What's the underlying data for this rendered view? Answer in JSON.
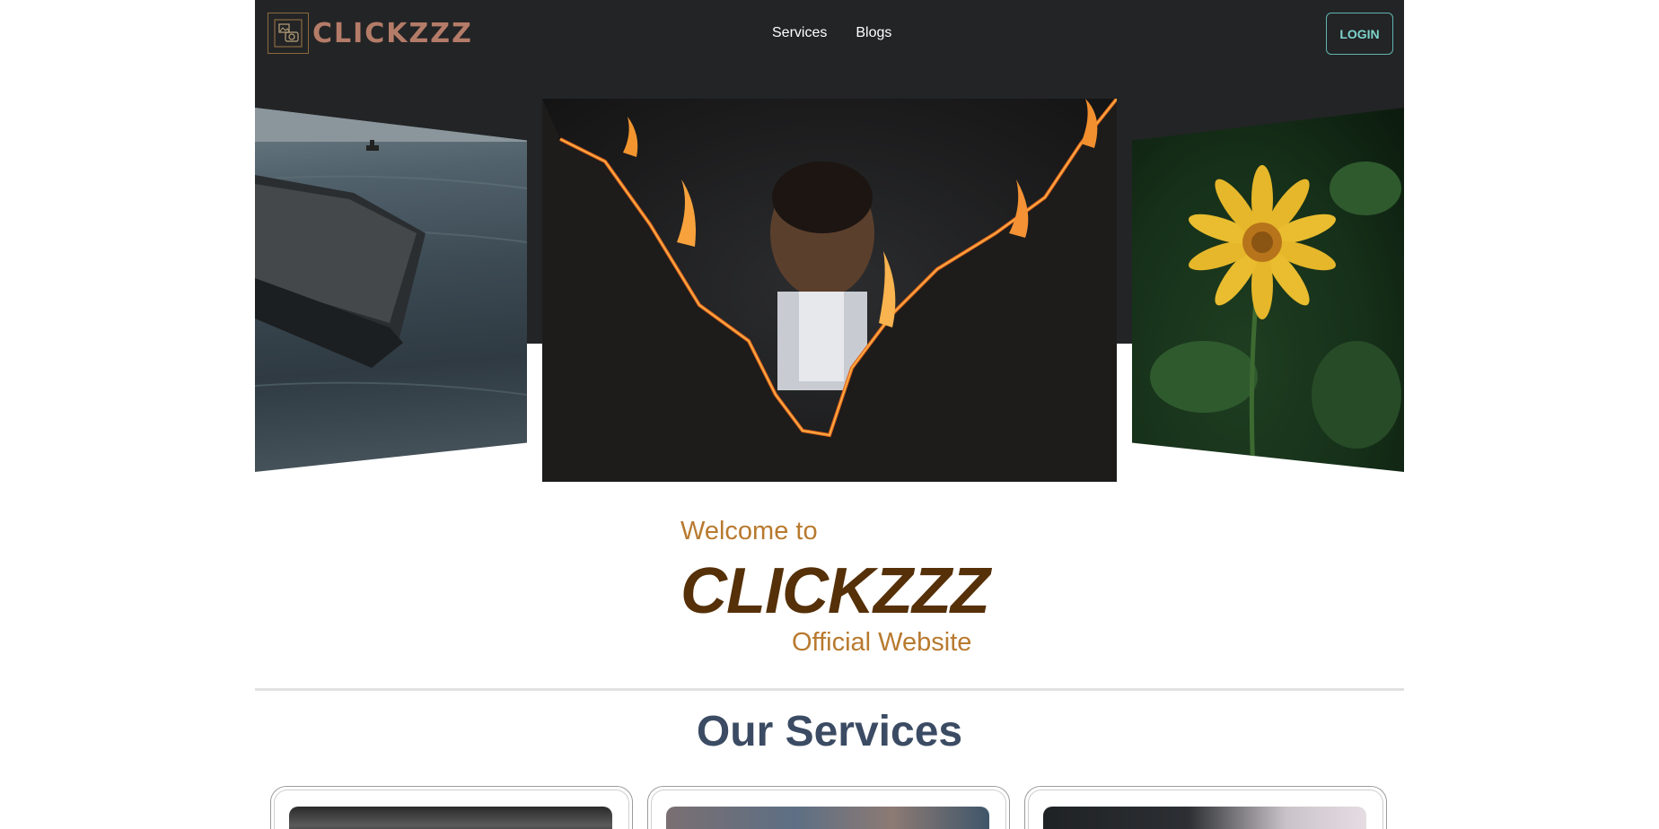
{
  "navbar": {
    "brand": "CLICKZZZ",
    "links": [
      "Services",
      "Blogs"
    ],
    "login_label": "LOGIN"
  },
  "hero": {
    "welcome": "Welcome to",
    "brand": "CLICKZZZ",
    "subtitle": "Official Website"
  },
  "services": {
    "title": "Our Services"
  },
  "colors": {
    "nav_bg": "#232426",
    "brand_accent": "#b87a2f",
    "brand_dark": "#553008",
    "heading": "#3b4b63",
    "login_border": "#5fb4b0"
  },
  "icons": {
    "logo": "camera-gallery-icon"
  }
}
